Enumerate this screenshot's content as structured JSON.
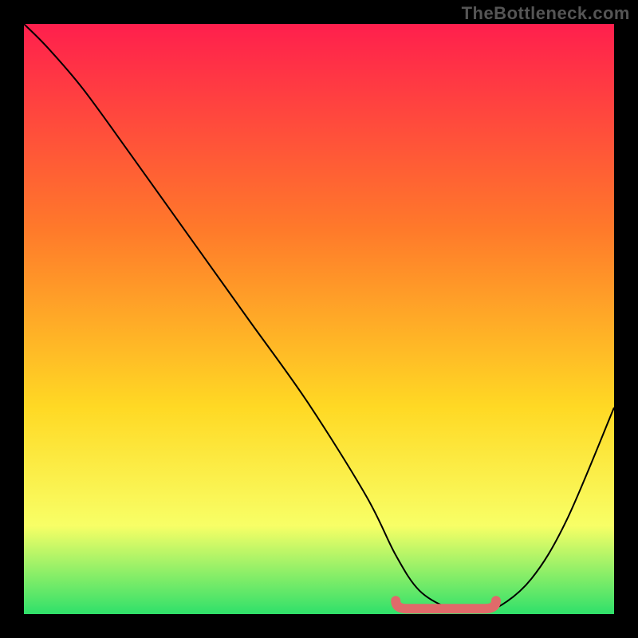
{
  "watermark": "TheBottleneck.com",
  "colors": {
    "frame": "#000000",
    "grad_top": "#ff1f4d",
    "grad_mid1": "#ff7a2a",
    "grad_mid2": "#ffd924",
    "grad_low": "#f8ff66",
    "grad_bottom": "#2fe06a",
    "curve": "#000000",
    "highlight": "#e06a6a"
  },
  "chart_data": {
    "type": "line",
    "title": "",
    "xlabel": "",
    "ylabel": "",
    "xlim": [
      0,
      100
    ],
    "ylim": [
      0,
      100
    ],
    "series": [
      {
        "name": "bottleneck-curve",
        "x": [
          0,
          4,
          10,
          18,
          28,
          38,
          48,
          58,
          63,
          67,
          72,
          76,
          80,
          86,
          92,
          100
        ],
        "y": [
          100,
          96,
          89,
          78,
          64,
          50,
          36,
          20,
          10,
          4,
          1,
          0.5,
          1,
          6,
          16,
          35
        ]
      }
    ],
    "annotations": [
      {
        "name": "optimal-range",
        "x0": 63,
        "x1": 80,
        "y": 0.5
      }
    ]
  }
}
